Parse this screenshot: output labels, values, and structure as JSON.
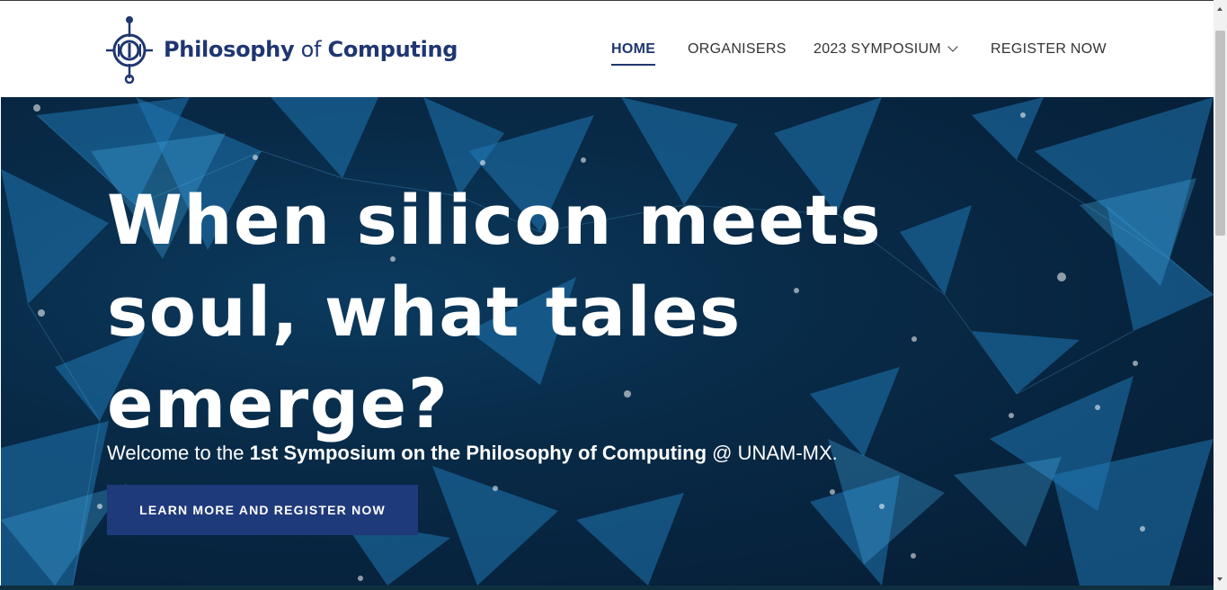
{
  "header": {
    "logo": {
      "icon": "circuit-o-icon",
      "brand_part1": "Philosophy",
      "brand_part2": "of",
      "brand_part3": "Computing",
      "color": "#1f3670"
    },
    "nav": [
      {
        "label": "HOME",
        "active": true
      },
      {
        "label": "ORGANISERS",
        "active": false
      },
      {
        "label": "2023 SYMPOSIUM",
        "active": false,
        "dropdown_icon": "chevron-down-icon"
      },
      {
        "label": "REGISTER NOW",
        "active": false
      }
    ]
  },
  "hero": {
    "headline": "When silicon meets soul, what tales emerge?",
    "subtitle_pre": "Welcome to the ",
    "subtitle_bold": "1st Symposium on the Philosophy of Computing",
    "subtitle_post": " @ UNAM-MX.",
    "cta_label": "LEARN MORE AND REGISTER NOW",
    "background": "blue-polygon-network-image"
  },
  "colors": {
    "brand": "#1f3670",
    "cta": "#1f3a7a",
    "hero_dark": "#061c33",
    "hero_accent": "#2e8fd1"
  }
}
